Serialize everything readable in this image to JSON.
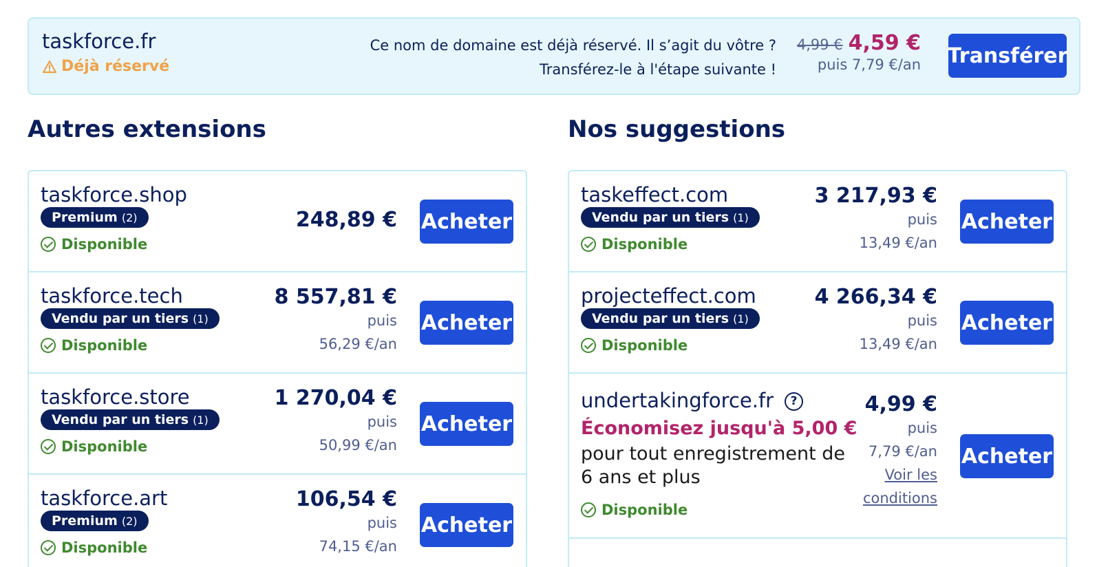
{
  "banner": {
    "domain": "taskforce.fr",
    "status": "Déjà réservé",
    "message_line1": "Ce nom de domaine est déjà réservé. Il s’agit du vôtre ?",
    "message_line2": "Transférez-le à l'étape suivante !",
    "old_price": "4,99 €",
    "price": "4,59 €",
    "renewal": "puis 7,79 €/an",
    "button": "Transférer"
  },
  "left": {
    "title": "Autres extensions",
    "rows": [
      {
        "domain": "taskforce.shop",
        "badge": "Premium",
        "badge_count": "(2)",
        "status": "Disponible",
        "price": "248,89 €",
        "then": "",
        "renewal": "",
        "button": "Acheter"
      },
      {
        "domain": "taskforce.tech",
        "badge": "Vendu par un tiers",
        "badge_count": "(1)",
        "status": "Disponible",
        "price": "8 557,81 €",
        "then": "puis",
        "renewal": "56,29 €/an",
        "button": "Acheter"
      },
      {
        "domain": "taskforce.store",
        "badge": "Vendu par un tiers",
        "badge_count": "(1)",
        "status": "Disponible",
        "price": "1 270,04 €",
        "then": "puis",
        "renewal": "50,99 €/an",
        "button": "Acheter"
      },
      {
        "domain": "taskforce.art",
        "badge": "Premium",
        "badge_count": "(2)",
        "status": "Disponible",
        "price": "106,54 €",
        "then": "puis",
        "renewal": "74,15 €/an",
        "button": "Acheter"
      }
    ]
  },
  "right": {
    "title": "Nos suggestions",
    "rows": [
      {
        "domain": "taskeffect.com",
        "badge": "Vendu par un tiers",
        "badge_count": "(1)",
        "status": "Disponible",
        "price": "3 217,93 €",
        "then": "puis",
        "renewal": "13,49 €/an",
        "button": "Acheter"
      },
      {
        "domain": "projecteffect.com",
        "badge": "Vendu par un tiers",
        "badge_count": "(1)",
        "status": "Disponible",
        "price": "4 266,34 €",
        "then": "puis",
        "renewal": "13,49 €/an",
        "button": "Acheter"
      },
      {
        "domain": "undertakingforce.fr",
        "savings": "Économisez jusqu'à 5,00 €",
        "savings_desc": "pour tout enregistrement de 6 ans et plus",
        "status": "Disponible",
        "price": "4,99 €",
        "then": "puis",
        "renewal": "7,79 €/an",
        "link_line1": "Voir les",
        "link_line2": "conditions",
        "button": "Acheter"
      }
    ]
  },
  "colors": {
    "primary_button": "#1f4fd8",
    "navy": "#0b1f5c",
    "available_green": "#3f8a2e",
    "promo_magenta": "#b1246a",
    "reserved_orange": "#f0a24a",
    "banner_bg": "#e6f6fc"
  },
  "icons": {
    "warning": "warning-triangle-icon",
    "available": "check-circle-icon",
    "help": "question-circle-icon"
  }
}
